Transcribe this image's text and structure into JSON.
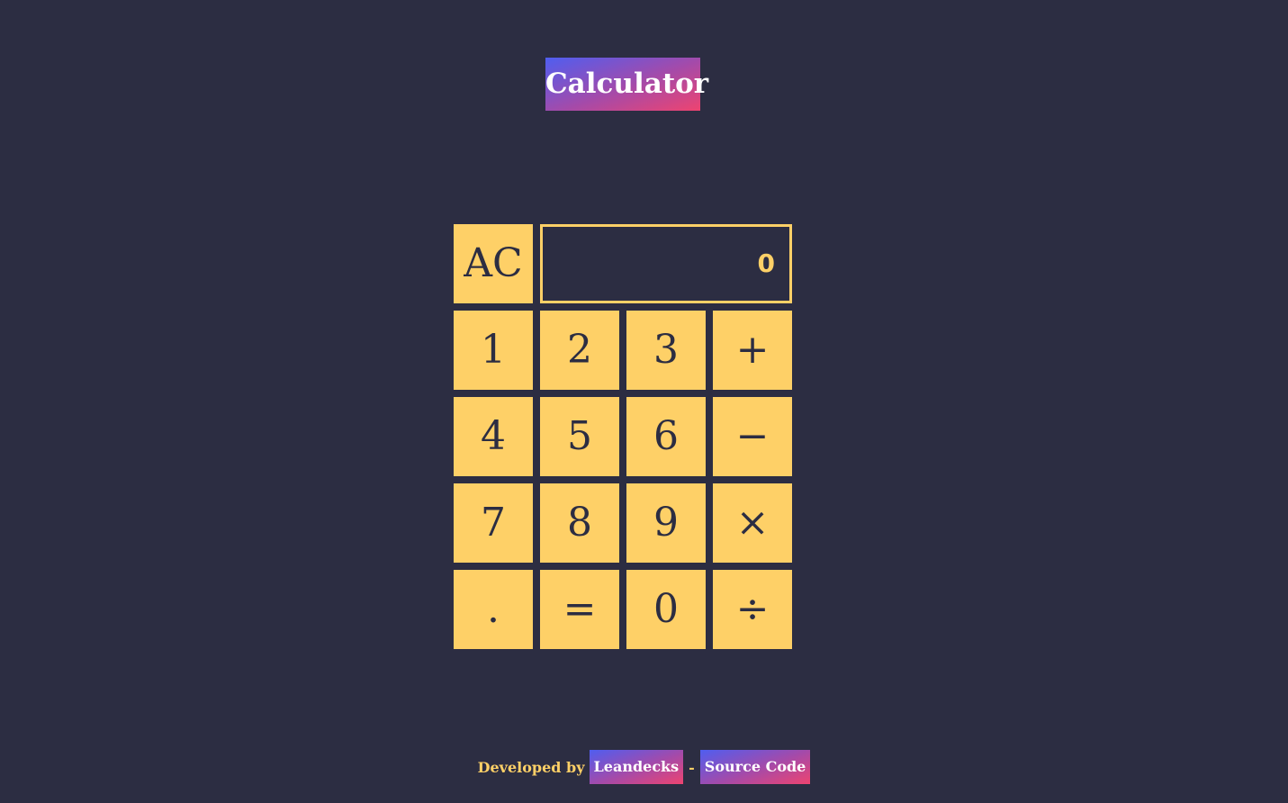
{
  "header": {
    "title": "Calculator"
  },
  "display": {
    "value": "0"
  },
  "keys": {
    "clear": "AC",
    "one": "1",
    "two": "2",
    "three": "3",
    "plus": "+",
    "four": "4",
    "five": "5",
    "six": "6",
    "minus": "−",
    "seven": "7",
    "eight": "8",
    "nine": "9",
    "multiply": "×",
    "decimal": ".",
    "equals": "=",
    "zero": "0",
    "divide": "÷"
  },
  "footer": {
    "developed_by": "Developed by",
    "author_link": "Leandecks",
    "separator": "-",
    "source_link": "Source Code"
  },
  "colors": {
    "background": "#2c2d42",
    "key": "#fed067",
    "key_text": "#2c2d42",
    "gradient_start": "#4f5ef0",
    "gradient_end": "#ee4470"
  }
}
